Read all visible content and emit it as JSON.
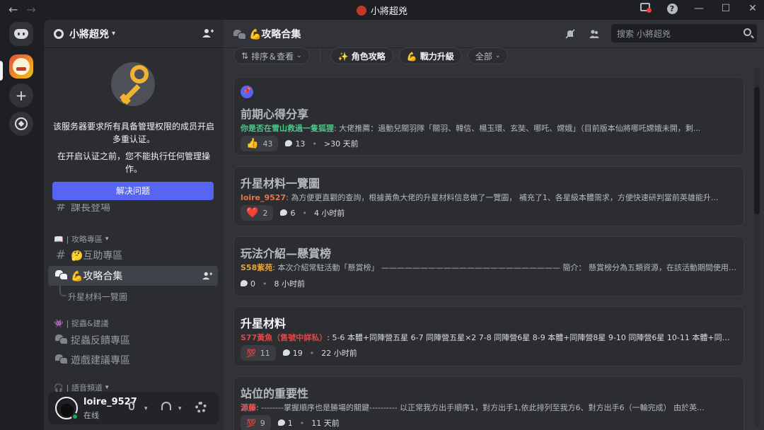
{
  "titlebar": {
    "title": "小將超兇"
  },
  "server": {
    "name": "小將超兇"
  },
  "notice": {
    "message1": "该服务器要求所有具备管理权限的成员开启多重认证。",
    "message2": "在开启认证之前，您不能执行任何管理操作。",
    "button": "解决问题"
  },
  "channels": {
    "partial": "課長登場",
    "cat1": "| 攻略專區",
    "cat1_emoji": "📖",
    "help": "🤔互助專區",
    "forum": "💪攻略合集",
    "thread": "升星材料一覽圖",
    "cat2": "| 捉蟲&建議",
    "cat2_emoji": "👾",
    "bug": "捉蟲反饋專區",
    "suggest": "遊戲建議專區",
    "cat3": "| 語音頻道"
  },
  "user": {
    "name": "loire_9527",
    "status": "在线"
  },
  "main": {
    "title": "💪攻略合集",
    "search_placeholder": "搜索 小將超兇",
    "sort_label": "排序＆查看",
    "tag1": "✨ 角色攻略",
    "tag2": "💪 戰力升級",
    "all_label": "全部"
  },
  "posts": [
    {
      "title": "前期心得分享",
      "author": "你是否在雪山救過一隻狐狸",
      "author_color": "#4dc48a",
      "preview": " 大佬推薦：過動兒關羽隊「關羽、韓信、楊玉環、玄奘、哪吒、嫦娥」（目前版本仙將哪吒嫦娥未開，剩...",
      "reaction_emoji": "👍",
      "reaction_count": "43",
      "comments": "13",
      "time": ">30 天前"
    },
    {
      "title": "升星材料一覽圖",
      "author": "loire_9527",
      "author_color": "#e8744f",
      "preview": " 為方便更直觀的查詢，根據黃魚大佬的升星材料信息做了一覽圖， 補充了1、各星級本體需求，方便快速研判當前英雄能升...",
      "reaction_emoji": "❤️",
      "reaction_count": "2",
      "comments": "6",
      "time": "4 小时前"
    },
    {
      "title": "玩法介紹—懸賞榜",
      "author": "S58紫苑",
      "author_color": "#e8a13d",
      "preview": " 本次介紹常駐活動「懸賞榜」 ——————————————————————— 簡介： 懸賞榜分為五類資源，在該活動期間使用各類資...",
      "reaction_emoji": "",
      "reaction_count": "",
      "comments": "0",
      "time": "8 小时前"
    },
    {
      "title": "升星材料",
      "author": "S77黃魚（售號中詳私）",
      "author_color": "#e04848",
      "preview": " 5-6 本體+同陣營五星 6-7 同陣營五星×2 7-8 同陣營6星 8-9 本體+同陣營8星 9-10 同陣營6星 10-11 本體+同陣營8...",
      "reaction_emoji": "💯",
      "reaction_count": "11",
      "comments": "19",
      "time": "22 小时前"
    },
    {
      "title": "站位的重要性",
      "author": "源藤",
      "author_color": "#e85a5a",
      "preview": " --------掌握順序也是勝場的關鍵---------- 以正常我方出手順序1，對方出手1,依此排列至我方6、對方出手6（一輪完成） 由於英...",
      "reaction_emoji": "💯",
      "reaction_count": "9",
      "comments": "1",
      "time": "11 天前"
    }
  ]
}
